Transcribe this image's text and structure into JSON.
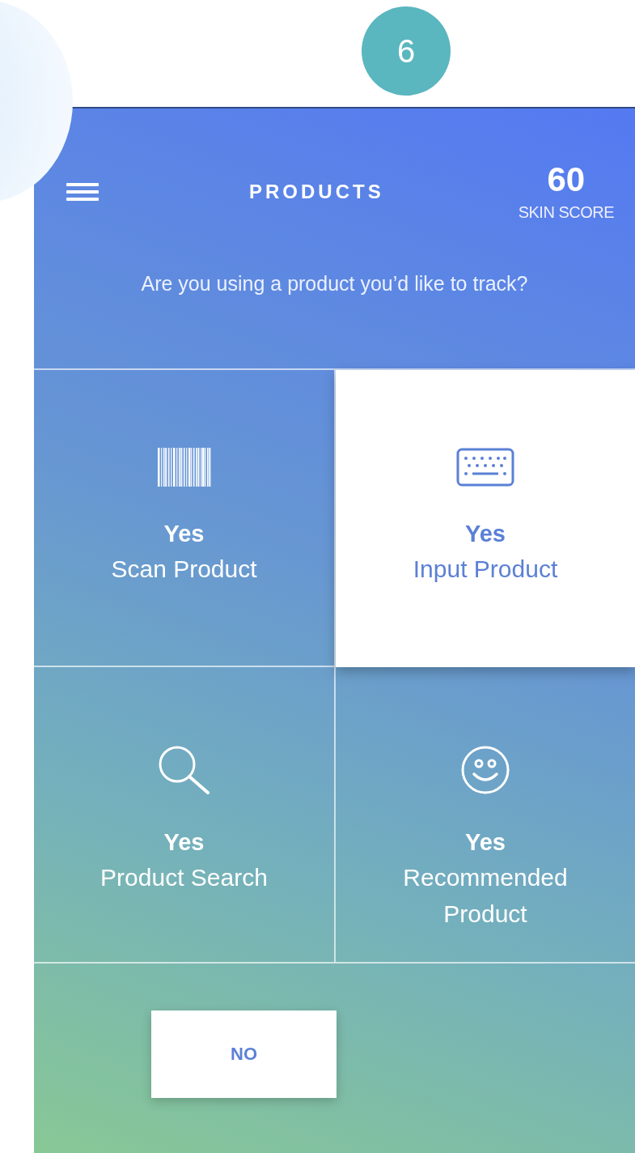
{
  "step_badge": "6",
  "header": {
    "title": "PRODUCTS",
    "score": "60",
    "score_label": "SKIN SCORE"
  },
  "question": "Are you using a product you’d like to track?",
  "options": [
    {
      "kind": "barcode",
      "title": "Yes",
      "label": "Scan Product",
      "selected": false
    },
    {
      "kind": "keyboard",
      "title": "Yes",
      "label": "Input Product",
      "selected": true
    },
    {
      "kind": "search",
      "title": "Yes",
      "label": "Product Search",
      "selected": false
    },
    {
      "kind": "smiley",
      "title": "Yes",
      "label": "Recommended Product",
      "selected": false
    }
  ],
  "no_button": "NO"
}
